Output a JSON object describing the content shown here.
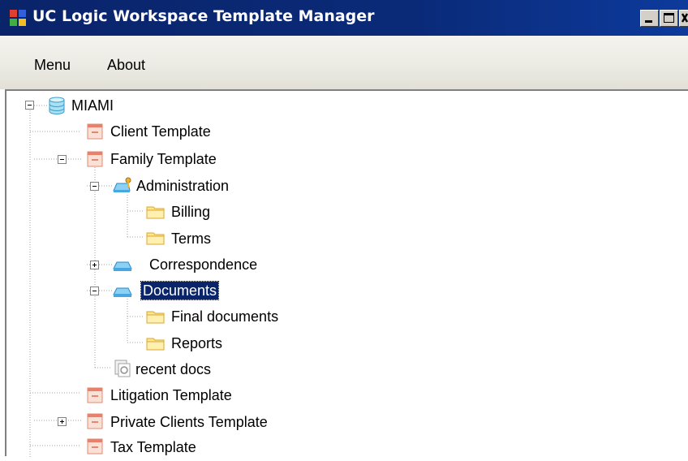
{
  "window": {
    "title": "UC Logic Workspace Template Manager"
  },
  "menu": {
    "items": [
      "Menu",
      "About"
    ]
  },
  "tree": {
    "root": "MIAMI",
    "nodes": [
      "Client Template",
      "Family Template",
      "Administration",
      "Billing",
      "Terms",
      "Correspondence",
      "Documents",
      "Final documents",
      "Reports",
      "recent docs",
      "Litigation Template",
      "Private Clients Template",
      "Tax Template"
    ],
    "selected": "Documents"
  },
  "colors": {
    "titlebar": "#0a246a",
    "selection": "#0a246a",
    "template_icon": "#e8806a",
    "folder_icon": "#ffe58a",
    "drawer_icon": "#46a8e0",
    "database_icon": "#5bc0e0"
  }
}
